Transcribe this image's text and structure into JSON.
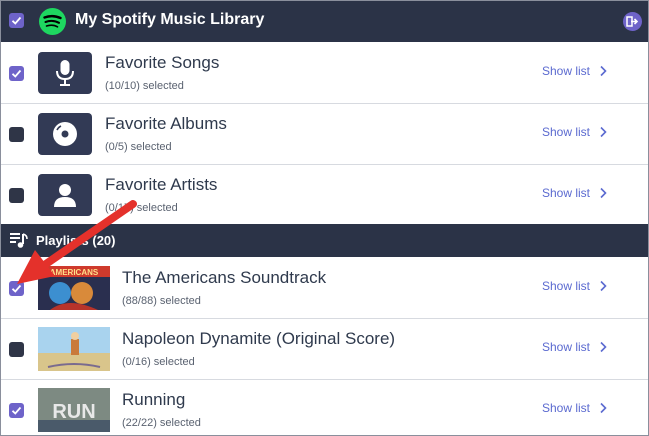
{
  "library": {
    "title": "My Spotify Music Library",
    "checked": true
  },
  "categories": [
    {
      "title": "Favorite Songs",
      "subtitle": "(10/10) selected",
      "icon": "microphone-icon",
      "checked": true,
      "action": "Show list"
    },
    {
      "title": "Favorite Albums",
      "subtitle": "(0/5) selected",
      "icon": "disc-icon",
      "checked": false,
      "action": "Show list"
    },
    {
      "title": "Favorite Artists",
      "subtitle": "(0/17) selected",
      "icon": "person-icon",
      "checked": false,
      "action": "Show list"
    }
  ],
  "playlists_header": {
    "label": "Playlists (20)"
  },
  "playlists": [
    {
      "title": "The Americans Soundtrack",
      "subtitle": "(88/88) selected",
      "checked": true,
      "action": "Show list",
      "art_text": "AMERICANS"
    },
    {
      "title": "Napoleon Dynamite (Original Score)",
      "subtitle": "(0/16) selected",
      "checked": false,
      "action": "Show list"
    },
    {
      "title": "Running",
      "subtitle": "(22/22) selected",
      "checked": true,
      "action": "Show list",
      "art_text": "RUN"
    }
  ],
  "colors": {
    "header_bg": "#2b3347",
    "accent": "#6e63c9",
    "link": "#5b6ad0",
    "annotation_arrow": "#e4312b"
  }
}
